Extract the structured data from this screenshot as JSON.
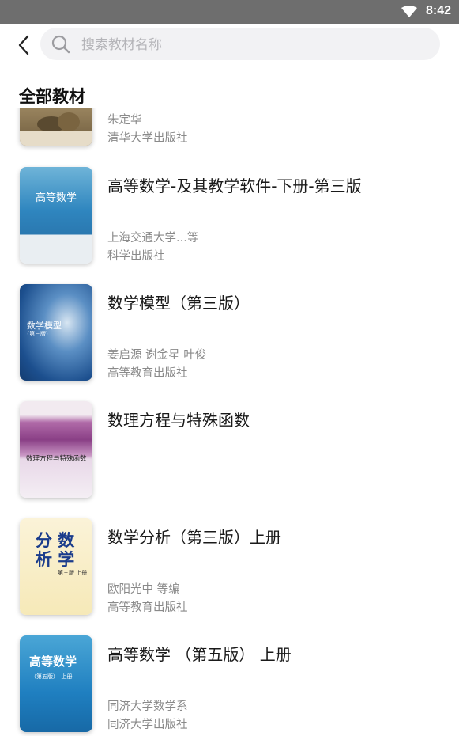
{
  "status_bar": {
    "time": "8:42"
  },
  "search": {
    "placeholder": "搜索教材名称"
  },
  "section": {
    "title": "全部教材"
  },
  "books": [
    {
      "title": "",
      "author": "朱定华",
      "publisher": "清华大学出版社"
    },
    {
      "title": "高等数学-及其教学软件-下册-第三版",
      "author": "上海交通大学...等",
      "publisher": "科学出版社",
      "cover_text": [
        "高等数学"
      ]
    },
    {
      "title": "数学模型（第三版）",
      "author": "姜启源 谢金星 叶俊",
      "publisher": "高等教育出版社",
      "cover_text": [
        "数学模型",
        "（第三版）"
      ]
    },
    {
      "title": "数理方程与特殊函数",
      "author": "",
      "publisher": "",
      "cover_text": [
        "数理方程与特殊函数"
      ]
    },
    {
      "title": "数学分析（第三版）上册",
      "author": "欧阳光中 等编",
      "publisher": "高等教育出版社",
      "cover_text": [
        "分 数",
        "析 学",
        "第三版 上册"
      ]
    },
    {
      "title": "高等数学 （第五版） 上册",
      "author": "同济大学数学系",
      "publisher": "同济大学出版社",
      "cover_text": [
        "高等数学",
        "（第五版）　上册"
      ]
    }
  ],
  "colors": {
    "status_bar": "#6e6e6e",
    "search_bg": "#f2f2f4",
    "secondary_text": "#8a8a8a"
  }
}
